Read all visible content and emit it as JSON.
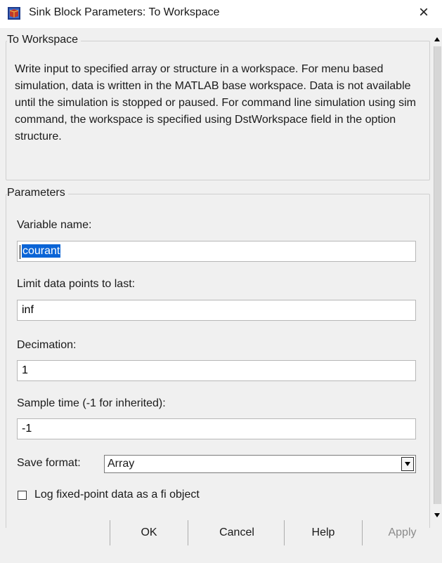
{
  "window": {
    "title": "Sink Block Parameters: To Workspace",
    "close_label": "×"
  },
  "block_group": {
    "legend": "To Workspace",
    "description": "Write input to specified array or structure in a workspace. For menu based simulation, data is written in the MATLAB base workspace. Data is not available until the simulation is stopped or paused. For command line simulation using sim command, the workspace is specified using DstWorkspace field in the option structure."
  },
  "parameters": {
    "legend": "Parameters",
    "variable_name_label": "Variable name:",
    "variable_name_value": "courant",
    "limit_label": "Limit data points to last:",
    "limit_value": "inf",
    "decimation_label": "Decimation:",
    "decimation_value": "1",
    "sample_time_label": "Sample time (-1 for inherited):",
    "sample_time_value": "-1",
    "save_format_label": "Save format:",
    "save_format_value": "Array",
    "log_fixed_point_label": "Log fixed-point data as a fi object",
    "log_fixed_point_checked": false
  },
  "buttons": {
    "ok": "OK",
    "cancel": "Cancel",
    "help": "Help",
    "apply": "Apply"
  },
  "colors": {
    "selection": "#0a64d6",
    "background": "#f0f0f0",
    "disabled_text": "#8a8a8a"
  },
  "icons": {
    "app": "simulink-block-icon",
    "scroll_up": "scroll-up-arrow-icon",
    "scroll_down": "scroll-down-arrow-icon",
    "dropdown": "chevron-down-icon"
  }
}
